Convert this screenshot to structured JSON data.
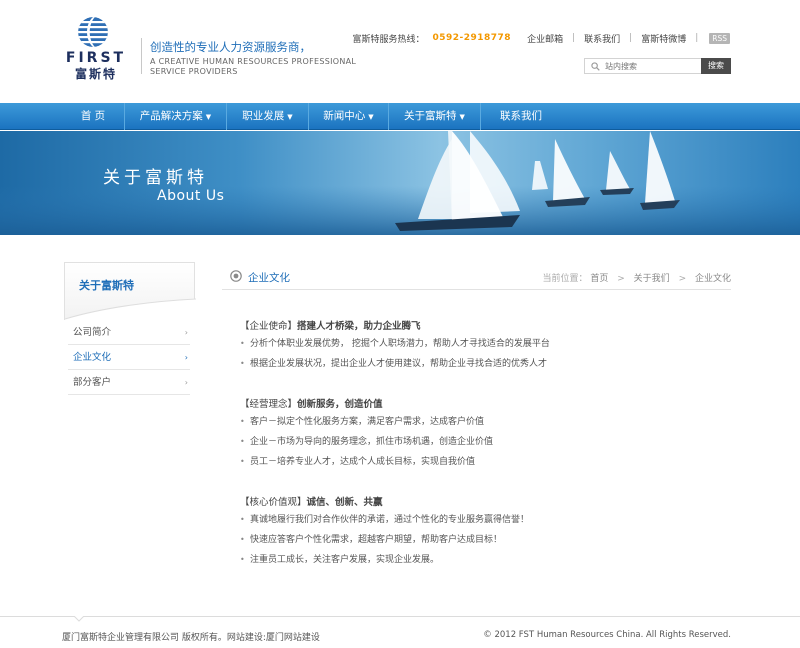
{
  "brand": {
    "logo_en": "FIRST",
    "logo_cn": "富斯特",
    "tagline_cn": "创造性的专业人力资源服务商，",
    "tagline_en_line1": "A CREATIVE HUMAN RESOURCES PROFESSIONAL",
    "tagline_en_line2": "SERVICE PROVIDERS"
  },
  "topbar": {
    "hotline_label": "富斯特服务热线：",
    "hotline_number": "0592-2918778",
    "links": [
      "企业邮箱",
      "联系我们",
      "富斯特微博"
    ],
    "rss": "RSS"
  },
  "search": {
    "placeholder": "站内搜索",
    "button": "搜索"
  },
  "nav": {
    "items": [
      {
        "label": "首 页",
        "dropdown": false
      },
      {
        "label": "产品解决方案",
        "dropdown": true
      },
      {
        "label": "职业发展",
        "dropdown": true
      },
      {
        "label": "新闻中心",
        "dropdown": true
      },
      {
        "label": "关于富斯特",
        "dropdown": true
      },
      {
        "label": "联系我们",
        "dropdown": false
      }
    ],
    "caret": "▼"
  },
  "banner": {
    "title_cn": "关于富斯特",
    "title_en": "About Us"
  },
  "sidebar": {
    "title": "关于富斯特",
    "items": [
      {
        "label": "公司简介",
        "active": false
      },
      {
        "label": "企业文化",
        "active": true
      },
      {
        "label": "部分客户",
        "active": false
      }
    ],
    "arrow": "›"
  },
  "content": {
    "title": "企业文化",
    "breadcrumb": {
      "label": "当前位置：",
      "items": [
        "首页",
        "关于我们",
        "企业文化"
      ],
      "sep": ">"
    },
    "sections": [
      {
        "heading": "【企业使命】",
        "subtitle": "搭建人才桥梁，助力企业腾飞",
        "bullets": [
          "分析个体职业发展优势， 挖掘个人职场潜力，帮助人才寻找适合的发展平台",
          "根据企业发展状况，提出企业人才使用建议，帮助企业寻找合适的优秀人才"
        ]
      },
      {
        "heading": "【经营理念】",
        "subtitle": "创新服务，创造价值",
        "bullets": [
          "客户－拟定个性化服务方案，满足客户需求，达成客户价值",
          "企业－市场为导向的服务理念，抓住市场机遇，创造企业价值",
          "员工－培养专业人才，达成个人成长目标，实现自我价值"
        ]
      },
      {
        "heading": "【核心价值观】",
        "subtitle": "诚信、创新、共赢",
        "bullets": [
          "真诚地履行我们对合作伙伴的承诺，通过个性化的专业服务赢得信誉！",
          " 快速应答客户个性化需求，超越客户期望，帮助客户达成目标！",
          "注重员工成长，关注客户发展，实现企业发展。"
        ]
      }
    ]
  },
  "footer": {
    "left": "厦门富斯特企业管理有限公司  版权所有。网站建设:厦门网站建设",
    "right": "© 2012 FST Human Resources China. All Rights Reserved."
  },
  "colors": {
    "brand_blue": "#1f6eb8",
    "nav_top": "#3d9ad9",
    "nav_bottom": "#1b73c0",
    "hotline": "#f39800",
    "logo_navy": "#1d2f5e"
  }
}
